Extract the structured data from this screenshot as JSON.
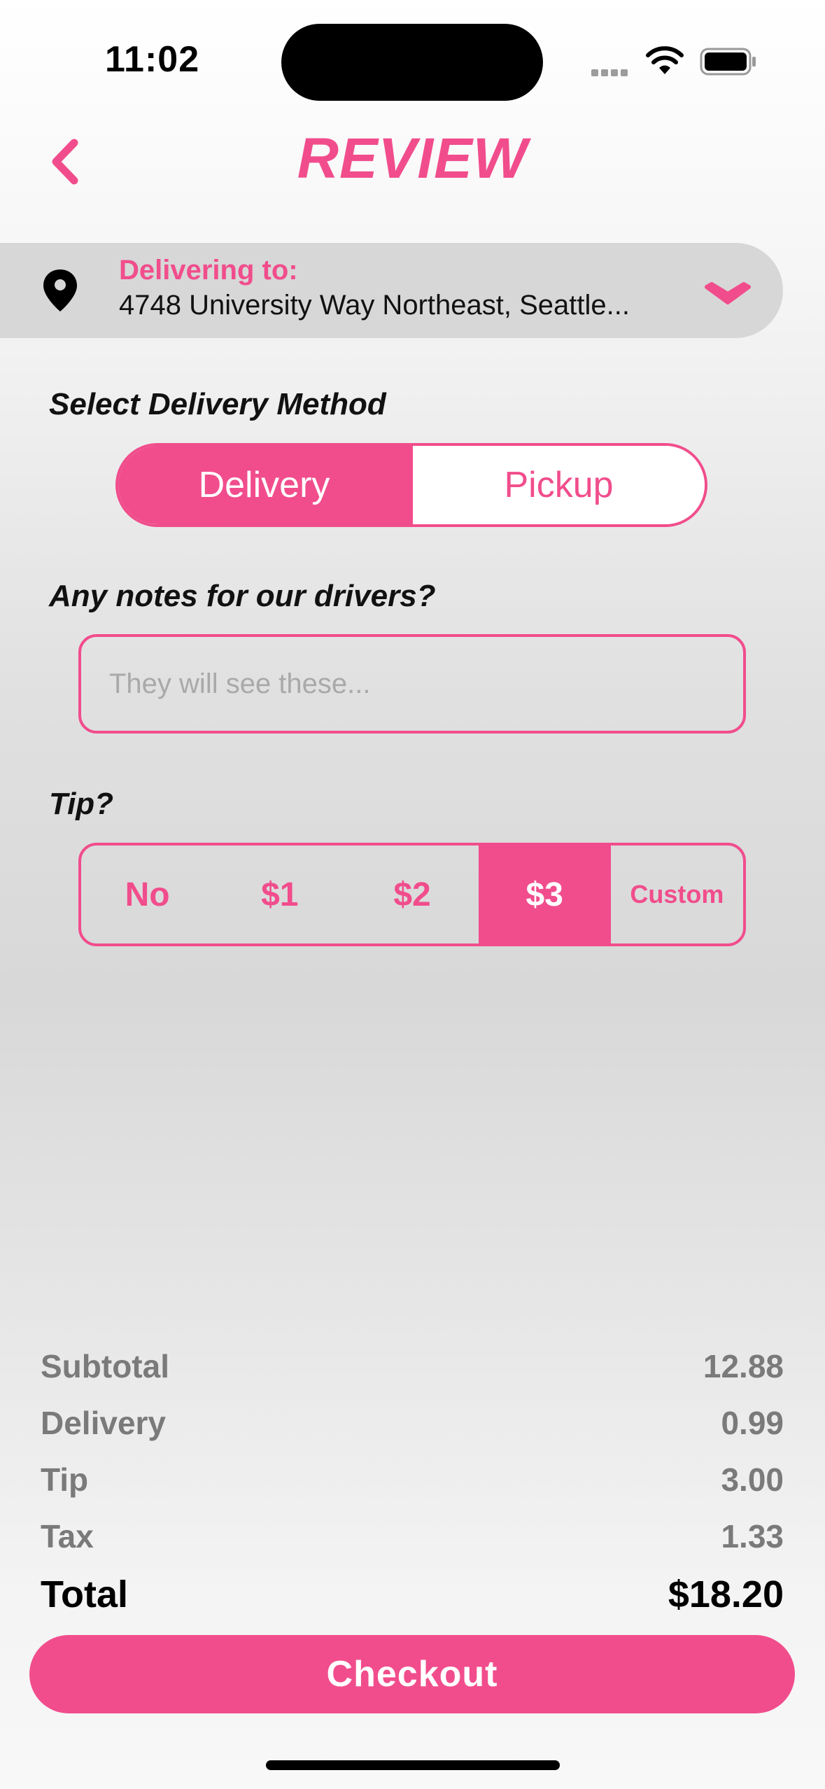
{
  "status_bar": {
    "time": "11:02"
  },
  "header": {
    "title": "REVIEW"
  },
  "address": {
    "label": "Delivering to:",
    "value": "4748 University Way Northeast, Seattle..."
  },
  "delivery_method": {
    "heading": "Select Delivery Method",
    "options": [
      "Delivery",
      "Pickup"
    ],
    "selected": "Delivery"
  },
  "notes": {
    "heading": "Any notes for our drivers?",
    "placeholder": "They will see these...",
    "value": ""
  },
  "tip": {
    "heading": "Tip?",
    "options": [
      "No",
      "$1",
      "$2",
      "$3",
      "Custom"
    ],
    "selected": "$3"
  },
  "summary": {
    "rows": [
      {
        "label": "Subtotal",
        "value": "12.88"
      },
      {
        "label": "Delivery",
        "value": "0.99"
      },
      {
        "label": "Tip",
        "value": "3.00"
      },
      {
        "label": "Tax",
        "value": "1.33"
      }
    ],
    "total_label": "Total",
    "total_value": "$18.20"
  },
  "checkout_label": "Checkout",
  "colors": {
    "accent": "#f14d8c",
    "address_bar": "#d7d7d7"
  }
}
